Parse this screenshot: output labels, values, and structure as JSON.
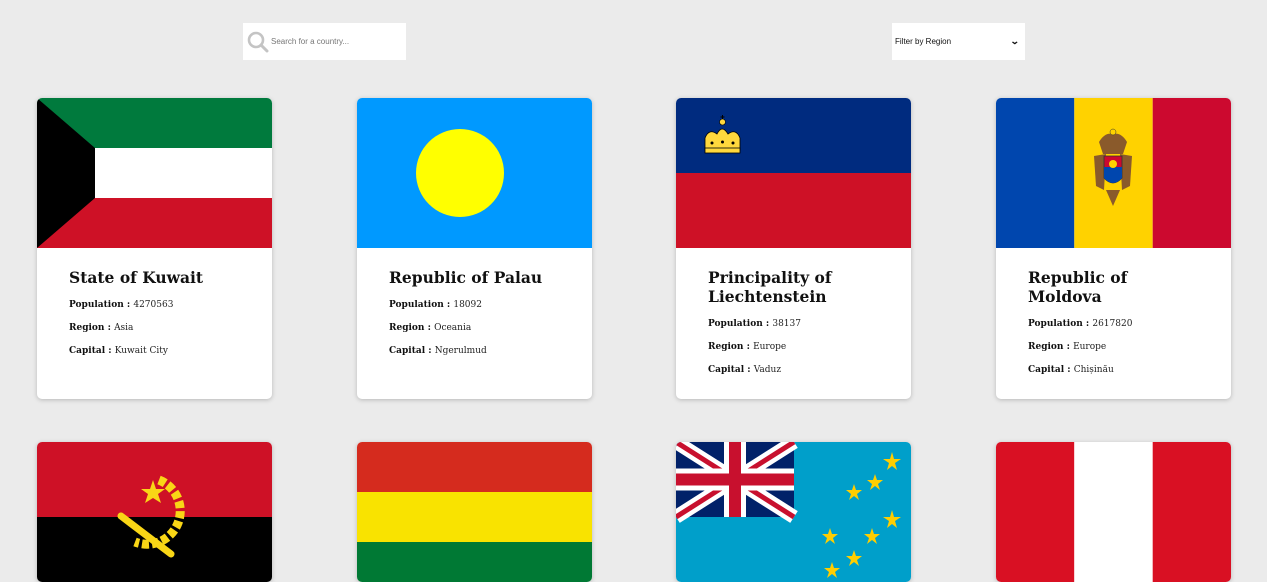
{
  "search": {
    "placeholder": "Search for a country..."
  },
  "filter": {
    "selected": "Filter by Region"
  },
  "labels": {
    "population": "Population",
    "region": "Region",
    "capital": "Capital",
    "separator": " : "
  },
  "countries": [
    {
      "name": "State of Kuwait",
      "population": "4270563",
      "region": "Asia",
      "capital": "Kuwait City"
    },
    {
      "name": "Republic of Palau",
      "population": "18092",
      "region": "Oceania",
      "capital": "Ngerulmud"
    },
    {
      "name": "Principality of Liechtenstein",
      "population": "38137",
      "region": "Europe",
      "capital": "Vaduz"
    },
    {
      "name": "Republic of Moldova",
      "population": "2617820",
      "region": "Europe",
      "capital": "Chișinău"
    }
  ]
}
